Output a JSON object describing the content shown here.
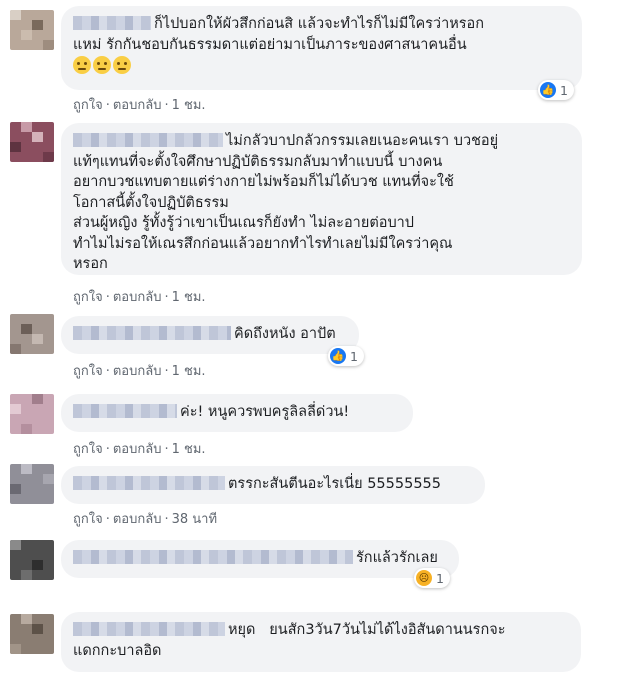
{
  "actions": {
    "like": "ถูกใจ",
    "reply": "ตอบกลับ",
    "separator": "·"
  },
  "comments": [
    {
      "text": "ก็ไปบอกให้ผัวสึกก่อนสิ แล้วจะทำไรก็ไม่มีใครว่าหรอก\nแหม่ รักกันชอบกันธรรมดาแต่อย่ามาเป็นภาระของศาสนาคนอื่น",
      "emojis": [
        "rolling-eyes",
        "rolling-eyes",
        "rolling-eyes"
      ],
      "time": "1 ชม.",
      "reaction": {
        "type": "like",
        "count": "1"
      }
    },
    {
      "text": "ไม่กลัวบาปกลัวกรรมเลยเนอะคนเรา บวชอยู่\nแท้ๆแทนที่จะตั้งใจศึกษาปฏิบัติธรรมกลับมาทำแบบนี้ บางคน\nอยากบวชแทบตายแต่ร่างกายไม่พร้อมก็ไม่ได้บวช แทนที่จะใช้\nโอกาสนี้ตั้งใจปฏิบัติธรรม\nส่วนผู้หญิง รู้ทั้งรู้ว่าเขาเป็นเณรก็ยังทำ ไม่ละอายต่อบาป\nทำไมไม่รอให้เณรสึกก่อนแล้วอยากทำไรทำเลยไม่มีใครว่าคุณ\nหรอก",
      "time": "1 ชม."
    },
    {
      "text": "คิดถึงหนัง อาปัต",
      "time": "1 ชม.",
      "reaction": {
        "type": "like",
        "count": "1"
      }
    },
    {
      "text": "ค่ะ! หนูควรพบครูลิลลี่ด่วน!",
      "time": "1 ชม."
    },
    {
      "text": "ตรรกะสันตีนอะไรเนี่ย 55555555",
      "time": "38 นาที"
    },
    {
      "text": "รักแล้วรักเลย",
      "time": "1 ชม.",
      "reaction": {
        "type": "sad",
        "count": "1"
      }
    },
    {
      "text": "หยุด   ยนสัก3วัน7วันไม่ได้ไงอิสันดานนรกจะ\nแดกกะบาลอิด",
      "time": ""
    }
  ],
  "colors": {
    "bubble": "#f2f3f5",
    "action_text": "#606770",
    "like_blue": "#1877f2",
    "sad_yellow": "#f7b125"
  }
}
